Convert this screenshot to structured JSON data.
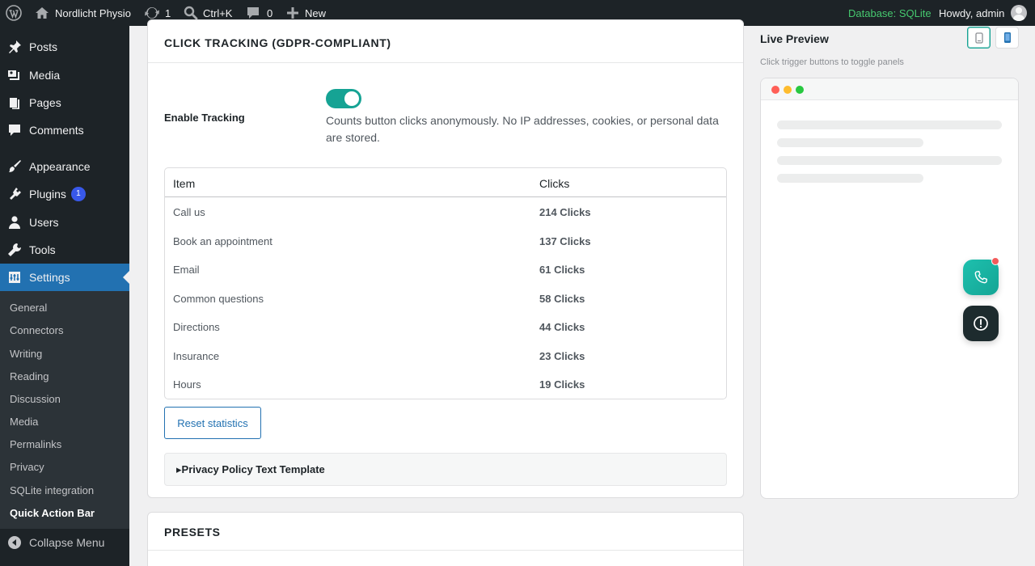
{
  "adminbar": {
    "site_name": "Nordlicht Physio",
    "updates_count": "1",
    "search_shortcut": "Ctrl+K",
    "comments_count": "0",
    "new_label": "New",
    "database_label": "Database: SQLite",
    "howdy": "Howdy, admin"
  },
  "sidebar": {
    "items": [
      {
        "label": "Posts",
        "icon": "pushpin-icon"
      },
      {
        "label": "Media",
        "icon": "media-icon"
      },
      {
        "label": "Pages",
        "icon": "pages-icon"
      },
      {
        "label": "Comments",
        "icon": "comment-icon"
      },
      {
        "label": "Appearance",
        "icon": "brush-icon"
      },
      {
        "label": "Plugins",
        "icon": "plugin-icon",
        "badge": "1"
      },
      {
        "label": "Users",
        "icon": "user-icon"
      },
      {
        "label": "Tools",
        "icon": "wrench-icon"
      },
      {
        "label": "Settings",
        "icon": "settings-icon"
      }
    ],
    "submenu": [
      "General",
      "Connectors",
      "Writing",
      "Reading",
      "Discussion",
      "Media",
      "Permalinks",
      "Privacy",
      "SQLite integration",
      "Quick Action Bar"
    ],
    "collapse_label": "Collapse Menu"
  },
  "tracking": {
    "title": "CLICK TRACKING (GDPR-COMPLIANT)",
    "enable_label": "Enable Tracking",
    "enabled": true,
    "description": "Counts button clicks anonymously. No IP addresses, cookies, or personal data are stored.",
    "table": {
      "col_item": "Item",
      "col_clicks": "Clicks",
      "rows": [
        {
          "item": "Call us",
          "clicks": "214 Clicks"
        },
        {
          "item": "Book an appointment",
          "clicks": "137 Clicks"
        },
        {
          "item": "Email",
          "clicks": "61 Clicks"
        },
        {
          "item": "Common questions",
          "clicks": "58 Clicks"
        },
        {
          "item": "Directions",
          "clicks": "44 Clicks"
        },
        {
          "item": "Insurance",
          "clicks": "23 Clicks"
        },
        {
          "item": "Hours",
          "clicks": "19 Clicks"
        }
      ]
    },
    "reset_label": "Reset statistics",
    "privacy_template_label": "▸Privacy Policy Text Template"
  },
  "presets": {
    "title": "PRESETS"
  },
  "preview": {
    "title": "Live Preview",
    "hint": "Click trigger buttons to toggle panels"
  },
  "colors": {
    "accent": "#16a394",
    "wp_blue": "#2271b1",
    "adminbar_bg": "#1d2327",
    "database_green": "#46c96f",
    "notification_red": "#f35b5b"
  }
}
